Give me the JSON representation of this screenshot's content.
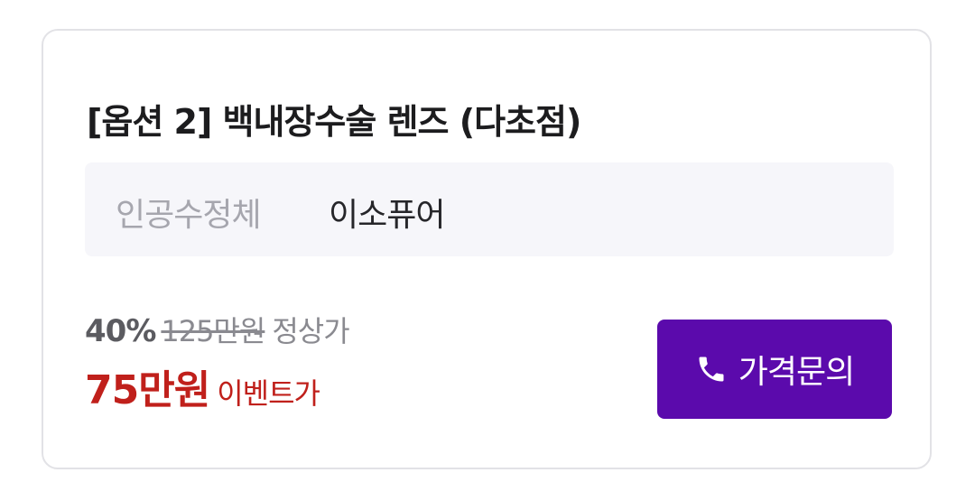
{
  "option": {
    "title": "[옵션 2] 백내장수술 렌즈 (다초점)"
  },
  "spec": {
    "label": "인공수정체",
    "value": "이소퓨어"
  },
  "price": {
    "discount": "40%",
    "original": "125만원",
    "regular_label": "정상가",
    "event": "75만원",
    "event_label": "이벤트가"
  },
  "cta": {
    "label": "가격문의",
    "icon": "phone-icon"
  },
  "colors": {
    "accent": "#5b0aac",
    "event_price": "#c0201b"
  }
}
